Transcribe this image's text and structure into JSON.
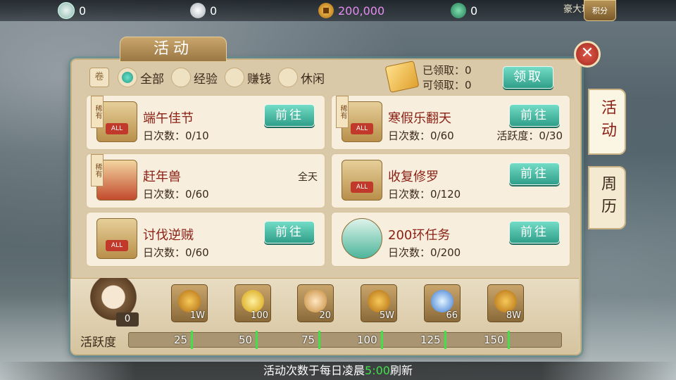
{
  "topbar": {
    "resources": [
      {
        "icon": "jade-token-icon",
        "value": "0"
      },
      {
        "icon": "silver-ingot-icon",
        "value": "0"
      },
      {
        "icon": "copper-coin-icon",
        "value": "200,000"
      },
      {
        "icon": "green-token-icon",
        "value": "0"
      }
    ],
    "right_text": "豪大理",
    "points_button": "积分"
  },
  "panel": {
    "title": "活动",
    "filters": {
      "fold_icon": "卷",
      "options": [
        {
          "label": "全部",
          "selected": true
        },
        {
          "label": "经验",
          "selected": false
        },
        {
          "label": "赚钱",
          "selected": false
        },
        {
          "label": "休闲",
          "selected": false
        }
      ]
    },
    "claim": {
      "claimed_label": "已领取：0",
      "claimable_label": "可领取：0",
      "button": "领取"
    },
    "activities": [
      {
        "name": "端午佳节",
        "count": "日次数：0/10",
        "rare": "稀有",
        "icon": "gift-bag-icon",
        "button": "前往"
      },
      {
        "name": "寒假乐翻天",
        "count": "日次数：0/60",
        "extra": "活跃度：0/30",
        "rare": "稀有",
        "icon": "gift-bag-icon",
        "button": "前往"
      },
      {
        "name": "赶年兽",
        "count": "日次数：0/60",
        "time": "全天",
        "rare": "稀有",
        "icon": "firecracker-icon"
      },
      {
        "name": "收复修罗",
        "count": "日次数：0/120",
        "icon": "gift-bag-icon",
        "button": "前往"
      },
      {
        "name": "讨伐逆贼",
        "count": "日次数：0/60",
        "icon": "gift-bag-icon",
        "button": "前往"
      },
      {
        "name": "200环任务",
        "count": "日次数：0/200",
        "icon": "jade-ring-icon",
        "button": "前往"
      }
    ],
    "side_tabs": [
      {
        "label": "活动",
        "active": true
      },
      {
        "label": "周历",
        "active": false
      }
    ]
  },
  "rewards": {
    "mascot_count": "0",
    "items": [
      {
        "icon": "copper-coin-icon",
        "amount": "1W"
      },
      {
        "icon": "gold-flower-icon",
        "amount": "100"
      },
      {
        "icon": "gold-ingot-icon",
        "amount": "20"
      },
      {
        "icon": "copper-coin-icon",
        "amount": "5W"
      },
      {
        "icon": "crystal-orb-icon",
        "amount": "66"
      },
      {
        "icon": "copper-coin-icon",
        "amount": "8W"
      }
    ],
    "activity_label": "活跃度",
    "milestones": [
      "25",
      "50",
      "75",
      "100",
      "125",
      "150"
    ],
    "progress_fraction": 0
  },
  "footer": {
    "before": "活动次数于每日凌晨",
    "time": "5:00",
    "after": "刷新"
  },
  "colors": {
    "accent_teal": "#2f9f89",
    "title_red": "#8a1f14",
    "milestone_green": "#42e04a"
  }
}
